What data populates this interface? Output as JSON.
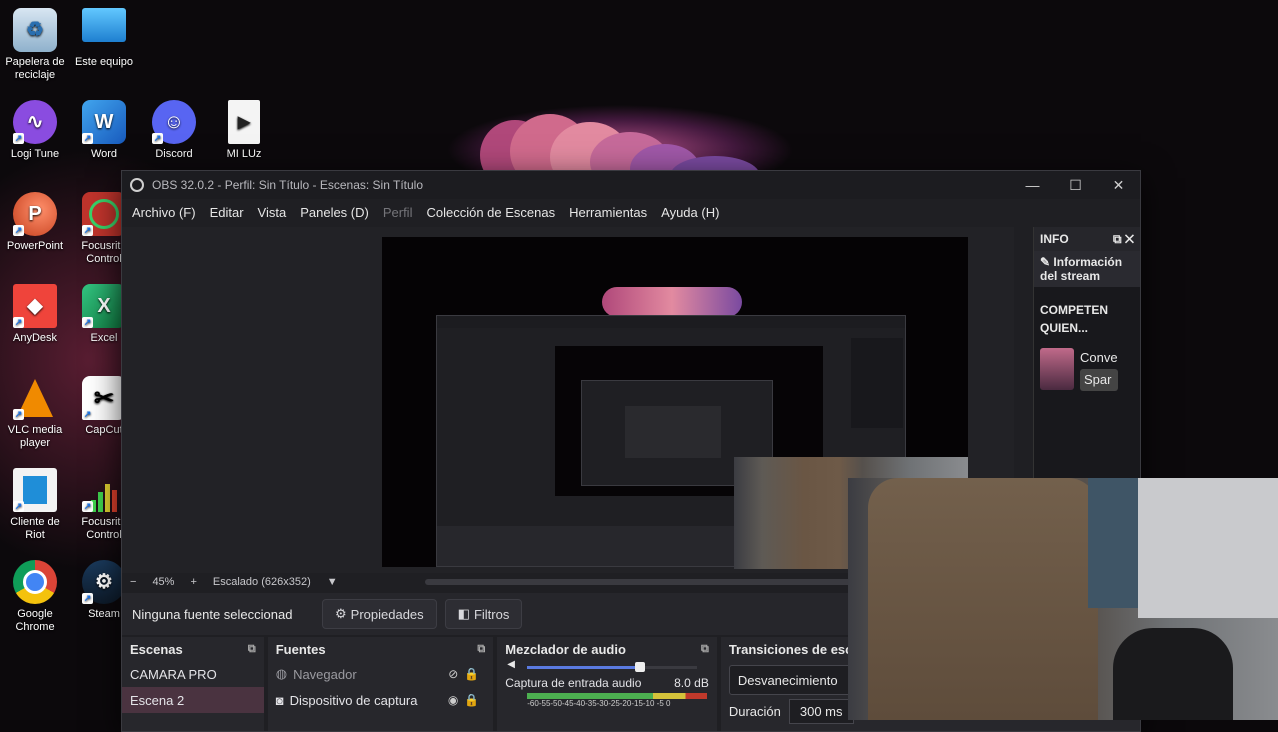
{
  "desktop": {
    "icons": [
      {
        "label": "Papelera de reciclaje",
        "icon": "recycle-bin-icon"
      },
      {
        "label": "Este equipo",
        "icon": "monitor-icon"
      },
      {
        "label": "Logi Tune",
        "icon": "logi-tune-icon"
      },
      {
        "label": "Word",
        "icon": "word-icon"
      },
      {
        "label": "Discord",
        "icon": "discord-icon"
      },
      {
        "label": "MI LUz",
        "icon": "video-file-icon"
      },
      {
        "label": "PowerPoint",
        "icon": "powerpoint-icon"
      },
      {
        "label": "Focusrite Control",
        "icon": "focusrite-icon"
      },
      {
        "label": "AnyDesk",
        "icon": "anydesk-icon"
      },
      {
        "label": "Excel",
        "icon": "excel-icon"
      },
      {
        "label": "VLC media player",
        "icon": "vlc-icon"
      },
      {
        "label": "CapCut",
        "icon": "capcut-icon"
      },
      {
        "label": "Cliente de Riot",
        "icon": "riot-icon"
      },
      {
        "label": "Focusrite Control",
        "icon": "focusrite-icon"
      },
      {
        "label": "Google Chrome",
        "icon": "chrome-icon"
      },
      {
        "label": "Steam",
        "icon": "steam-icon"
      }
    ]
  },
  "obs": {
    "title": "OBS 32.0.2 - Perfil: Sin Título - Escenas: Sin Título",
    "menu": [
      {
        "label": "Archivo (F)",
        "enabled": true
      },
      {
        "label": "Editar",
        "enabled": true
      },
      {
        "label": "Vista",
        "enabled": true
      },
      {
        "label": "Paneles (D)",
        "enabled": true
      },
      {
        "label": "Perfil",
        "enabled": false
      },
      {
        "label": "Colección de Escenas",
        "enabled": true
      },
      {
        "label": "Herramientas",
        "enabled": true
      },
      {
        "label": "Ayuda (H)",
        "enabled": true
      }
    ],
    "zoom": {
      "minus": "−",
      "value": "45%",
      "plus": "+",
      "scale": "Escalado (626x352)",
      "dropdown": "▼"
    },
    "info_dock": {
      "title": "INFO",
      "stream_info": "Información del stream",
      "event_title": "COMPETEN QUIEN...",
      "item1": "Conve",
      "item2": "Spar"
    },
    "source_bar": {
      "no_source": "Ninguna fuente seleccionad",
      "properties": "Propiedades",
      "filters": "Filtros"
    },
    "scenes": {
      "title": "Escenas",
      "items": [
        "CAMARA PRO",
        "Escena 2"
      ]
    },
    "sources": {
      "title": "Fuentes",
      "items": [
        "Navegador",
        "Dispositivo de captura de"
      ]
    },
    "mixer": {
      "title": "Mezclador de audio",
      "channel": "Captura de entrada audio",
      "db": "8.0 dB",
      "scale": "-60-55-50-45-40-35-30-25-20-15-10 -5  0"
    },
    "transitions": {
      "title": "Transiciones de esc",
      "selected": "Desvanecimiento",
      "duration_label": "Duración",
      "duration_value": "300 ms"
    }
  },
  "colors": {
    "accent": "#4a3340",
    "window": "#1f1f23",
    "meter_green": "#4caf50",
    "meter_yellow": "#d4c23a"
  }
}
